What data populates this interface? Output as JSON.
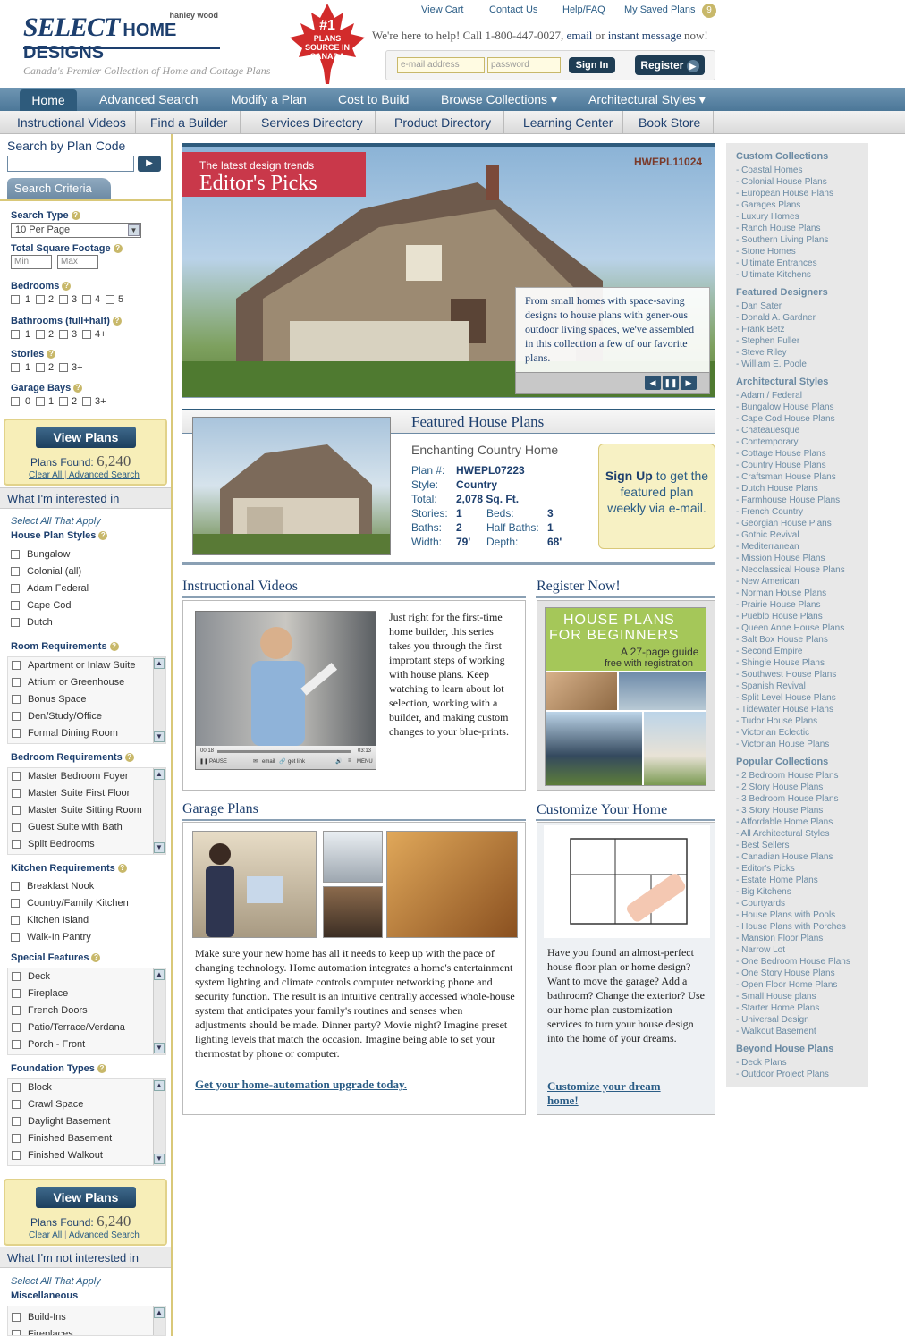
{
  "header": {
    "brand_select": "SELECT",
    "brand_rest": "HOME DESIGNS",
    "publisher": "hanley wood",
    "tagline": "Canada's Premier Collection of Home and Cottage Plans",
    "badge_number": "#1",
    "badge_text_1": "PLANS",
    "badge_text_2": "SOURCE IN",
    "badge_text_3": "CANADA",
    "top_links": [
      "View Cart",
      "Contact Us",
      "Help/FAQ",
      "My Saved Plans"
    ],
    "saved_count": "9",
    "help_prefix": "We're here to help! Call 1-800-447-0027,",
    "help_email": "email",
    "help_or": "or",
    "help_im": "instant message",
    "help_suffix": "now!",
    "email_placeholder": "e-mail address",
    "password_placeholder": "password",
    "signin_label": "Sign In",
    "register_label": "Register"
  },
  "nav_primary": [
    "Home",
    "Advanced Search",
    "Modify a Plan",
    "Cost to Build",
    "Browse Collections ▾",
    "Architectural Styles ▾"
  ],
  "nav_secondary": [
    "Instructional Videos",
    "Find a Builder",
    "Services Directory",
    "Product Directory",
    "Learning Center",
    "Book Store"
  ],
  "sidebar": {
    "search_code_label": "Search by Plan Code",
    "criteria_tab": "Search Criteria",
    "search_type_label": "Search Type",
    "search_type_value": "10 Per Page",
    "sqft_label": "Total Square Footage",
    "min": "Min",
    "max": "Max",
    "bedrooms_label": "Bedrooms",
    "bedrooms": [
      "1",
      "2",
      "3",
      "4",
      "5"
    ],
    "bathrooms_label": "Bathrooms (full+half)",
    "bathrooms": [
      "1",
      "2",
      "3",
      "4+"
    ],
    "stories_label": "Stories",
    "stories": [
      "1",
      "2",
      "3+"
    ],
    "garage_label": "Garage Bays",
    "garage": [
      "0",
      "1",
      "2",
      "3+"
    ],
    "view_plans": "View Plans",
    "plans_found_label": "Plans Found:",
    "plans_found": "6,240",
    "clear_all": "Clear All",
    "adv_search": "Advanced Search",
    "interested_label": "What I'm interested in",
    "select_all": "Select All That Apply",
    "styles_label": "House Plan Styles",
    "styles": [
      "Bungalow",
      "Colonial (all)",
      "Adam Federal",
      "Cape Cod",
      "Dutch"
    ],
    "room_label": "Room Requirements",
    "rooms": [
      "Apartment or Inlaw Suite",
      "Atrium or Greenhouse",
      "Bonus Space",
      "Den/Study/Office",
      "Formal Dining Room"
    ],
    "bedroom_req_label": "Bedroom Requirements",
    "bedroom_reqs": [
      "Master Bedroom Foyer",
      "Master Suite First Floor",
      "Master Suite Sitting Room",
      "Guest Suite with Bath",
      "Split Bedrooms"
    ],
    "kitchen_label": "Kitchen Requirements",
    "kitchens": [
      "Breakfast Nook",
      "Country/Family Kitchen",
      "Kitchen Island",
      "Walk-In Pantry"
    ],
    "special_label": "Special Features",
    "specials": [
      "Deck",
      "Fireplace",
      "French Doors",
      "Patio/Terrace/Verdana",
      "Porch - Front"
    ],
    "foundation_label": "Foundation Types",
    "foundations": [
      "Block",
      "Crawl Space",
      "Daylight Basement",
      "Finished Basement",
      "Finished Walkout"
    ],
    "not_interested_label": "What I'm not interested in",
    "misc_label": "Miscellaneous",
    "misc": [
      "Build-Ins",
      "Fireplaces"
    ]
  },
  "hero": {
    "kicker": "The latest design trends",
    "title": "Editor's Picks",
    "code": "HWEPL11024",
    "caption": "From small homes with space-saving designs to house plans with gener-ous outdoor living spaces, we've assembled in this collection a few of our favorite plans."
  },
  "featured": {
    "title": "Featured House Plans",
    "name": "Enchanting Country Home",
    "plan_label": "Plan #:",
    "plan": "HWEPL07223",
    "style_label": "Style:",
    "style": "Country",
    "total_label": "Total:",
    "total": "2,078 Sq. Ft.",
    "stories_label": "Stories:",
    "stories": "1",
    "beds_label": "Beds:",
    "beds": "3",
    "baths_label": "Baths:",
    "baths": "2",
    "half_label": "Half Baths:",
    "half": "1",
    "width_label": "Width:",
    "width": "79'",
    "depth_label": "Depth:",
    "depth": "68'",
    "signup_link": "Sign Up",
    "signup_text": "to get the featured plan weekly via e-mail."
  },
  "videos": {
    "title": "Instructional Videos",
    "text": "Just right for the first-time home builder, this series takes you through the first improtant steps of working with house plans. Keep watching to learn about lot selection, working with a builder, and making custom changes to your blue-prints.",
    "time_start": "00:18",
    "time_end": "03:13",
    "pause": "PAUSE",
    "email": "email",
    "getlink": "get link",
    "menu": "MENU"
  },
  "register": {
    "title": "Register Now!",
    "guide_1": "HOUSE PLANS",
    "guide_2": "FOR BEGINNERS",
    "guide_3": "A 27-page guide",
    "guide_4": "free with registration"
  },
  "garage": {
    "title": "Garage Plans",
    "text": "Make sure your new home has all it needs to keep up with the pace of changing technology. Home automation integrates a home's entertainment system lighting and climate controls computer networking phone and security function. The result is an intuitive centrally accessed whole-house system that anticipates your family's routines and senses when adjustments should be made. Dinner party? Movie night? Imagine preset lighting levels that match the occasion. Imagine being able to set your thermostat by phone or computer.",
    "link": "Get your home-automation upgrade today."
  },
  "customize": {
    "title": "Customize Your Home",
    "text": "Have you found an almost-perfect house floor plan or home design? Want to move the garage? Add a bathroom? Change the exterior? Use our home plan customization services to turn your house design into the home of your dreams.",
    "link": "Customize your dream home!"
  },
  "right": {
    "custom_h": "Custom Collections",
    "custom": [
      "Coastal Homes",
      "Colonial House Plans",
      "European House Plans",
      "Garages Plans",
      "Luxury Homes",
      "Ranch House Plans",
      "Southern Living Plans",
      "Stone Homes",
      "Ultimate Entrances",
      "Ultimate Kitchens"
    ],
    "designers_h": "Featured Designers",
    "designers": [
      "Dan Sater",
      "Donald A. Gardner",
      "Frank Betz",
      "Stephen Fuller",
      "Steve Riley",
      "William E. Poole"
    ],
    "arch_h": "Architectural Styles",
    "arch": [
      "Adam / Federal",
      "Bungalow House Plans",
      "Cape Cod House Plans",
      "Chateauesque",
      "Contemporary",
      "Cottage House Plans",
      "Country House Plans",
      "Craftsman House Plans",
      "Dutch House Plans",
      "Farmhouse House Plans",
      "French Country",
      "Georgian House Plans",
      "Gothic Revival",
      "Mediterranean",
      "Mission House Plans",
      "Neoclassical House Plans",
      "New American",
      "Norman House Plans",
      "Prairie House Plans",
      "Pueblo House Plans",
      "Queen Anne House Plans",
      "Salt Box House Plans",
      "Second Empire",
      "Shingle House Plans",
      "Southwest House Plans",
      "Spanish Revival",
      "Split Level House Plans",
      "Tidewater House Plans",
      "Tudor House Plans",
      "Victorian Eclectic",
      "Victorian House Plans"
    ],
    "popular_h": "Popular Collections",
    "popular": [
      "2 Bedroom House Plans",
      "2 Story House Plans",
      "3 Bedroom House Plans",
      "3 Story House Plans",
      "Affordable Home Plans",
      "All Architectural Styles",
      "Best Sellers",
      "Canadian House Plans",
      "Editor's Picks",
      "Estate Home Plans",
      "Big Kitchens",
      "Courtyards",
      "House Plans with Pools",
      "House Plans with Porches",
      "Mansion Floor Plans",
      "Narrow Lot",
      "One Bedroom House Plans",
      "One Story House Plans",
      "Open Floor Home Plans",
      "Small House plans",
      "Starter Home Plans",
      "Universal Design",
      "Walkout Basement"
    ],
    "beyond_h": "Beyond House Plans",
    "beyond": [
      "Deck Plans",
      "Outdoor Project Plans"
    ]
  },
  "colors": {
    "nav": "#4c7798",
    "accent": "#d9c879",
    "hero_red": "#c9384a",
    "link": "#2b5d86"
  }
}
